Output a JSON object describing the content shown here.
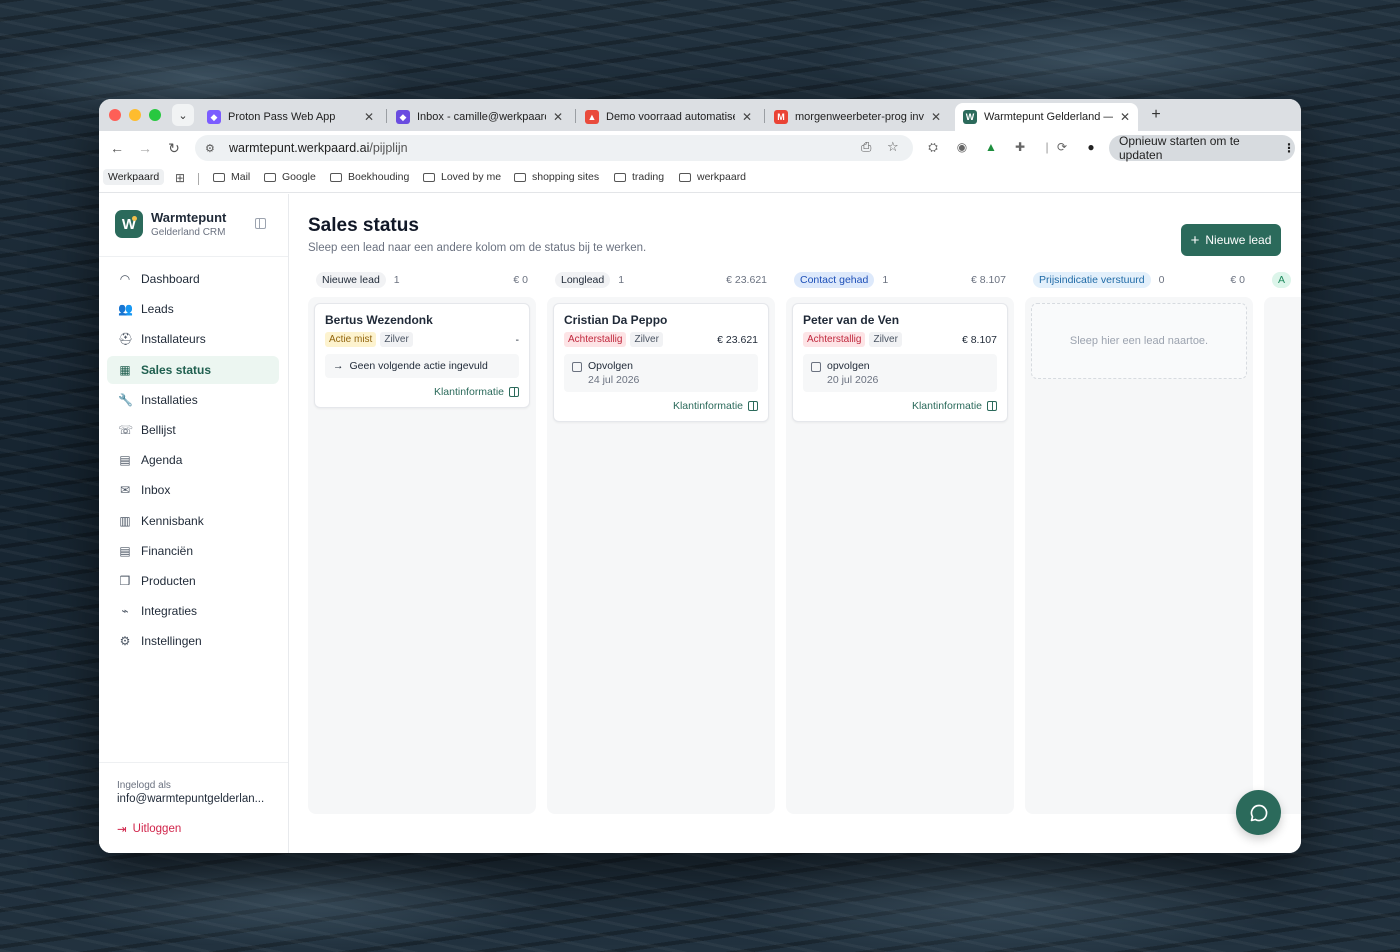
{
  "browser": {
    "tabs": [
      {
        "title": "Proton Pass Web App",
        "favicon_color": "#7b5cff",
        "active": false
      },
      {
        "title": "Inbox - camille@werkpaard.ai",
        "favicon_color": "#6a4ce0",
        "active": false
      },
      {
        "title": "Demo voorraad automatisering",
        "favicon_color": "#e94b3c",
        "active": false
      },
      {
        "title": "morgenweerbeter-prog invite",
        "favicon_color": "#ea4335",
        "active": false
      },
      {
        "title": "Warmtepunt Gelderland — CRM",
        "favicon_color": "#2b6a5b",
        "active": true
      }
    ],
    "url_host": "warmtepunt.werkpaard.ai",
    "url_path": "/pijplijn",
    "update_button": "Opnieuw starten om te updaten",
    "bookmarks": {
      "profile": "Werkpaard",
      "folders": [
        "Mail",
        "Google",
        "Boekhouding",
        "Loved by me",
        "shopping sites",
        "trading",
        "werkpaard"
      ]
    }
  },
  "sidebar": {
    "brand_name": "Warmtepunt",
    "brand_sub": "Gelderland CRM",
    "items": [
      {
        "label": "Dashboard",
        "icon": "gauge-icon",
        "glyph": "◠",
        "active": false
      },
      {
        "label": "Leads",
        "icon": "users-icon",
        "glyph": "👥",
        "active": false
      },
      {
        "label": "Installateurs",
        "icon": "hardhat-icon",
        "glyph": "⛑",
        "active": false
      },
      {
        "label": "Sales status",
        "icon": "kanban-icon",
        "glyph": "▦",
        "active": true
      },
      {
        "label": "Installaties",
        "icon": "wrench-icon",
        "glyph": "🔧",
        "active": false
      },
      {
        "label": "Bellijst",
        "icon": "phone-icon",
        "glyph": "☏",
        "active": false
      },
      {
        "label": "Agenda",
        "icon": "calendar-icon",
        "glyph": "▤",
        "active": false
      },
      {
        "label": "Inbox",
        "icon": "inbox-icon",
        "glyph": "✉",
        "active": false
      },
      {
        "label": "Kennisbank",
        "icon": "library-icon",
        "glyph": "▥",
        "active": false
      },
      {
        "label": "Financiën",
        "icon": "receipt-icon",
        "glyph": "▤",
        "active": false
      },
      {
        "label": "Producten",
        "icon": "package-icon",
        "glyph": "❒",
        "active": false
      },
      {
        "label": "Integraties",
        "icon": "plug-icon",
        "glyph": "⌁",
        "active": false
      },
      {
        "label": "Instellingen",
        "icon": "gear-icon",
        "glyph": "⚙",
        "active": false
      }
    ],
    "logged_in_label": "Ingelogd als",
    "logged_in_email": "info@warmtepuntgelderlan...",
    "logout_label": "Uitloggen"
  },
  "main": {
    "title": "Sales status",
    "subtitle": "Sleep een lead naar een andere kolom om de status bij te werken.",
    "new_lead_label": "Nieuwe lead",
    "columns": [
      {
        "name": "Nieuwe lead",
        "count": "1",
        "total": "€ 0",
        "badge_bg": "#f1f2f4",
        "badge_color": "#1f2937",
        "cards": [
          {
            "name": "Bertus Wezendonk",
            "status": "Actie mist",
            "status_type": "warn",
            "tier": "Zilver",
            "amount": "-",
            "action": "Geen volgende actie ingevuld",
            "link": "Klantinformatie"
          }
        ]
      },
      {
        "name": "Longlead",
        "count": "1",
        "total": "€ 23.621",
        "badge_bg": "#f1f2f4",
        "badge_color": "#1f2937",
        "cards": [
          {
            "name": "Cristian Da Peppo",
            "status": "Achterstallig",
            "status_type": "overdue",
            "tier": "Zilver",
            "amount": "€ 23.621",
            "task_title": "Opvolgen",
            "task_date": "24 jul 2026",
            "link": "Klantinformatie"
          }
        ]
      },
      {
        "name": "Contact gehad",
        "count": "1",
        "total": "€ 8.107",
        "badge_bg": "#dde9fb",
        "badge_color": "#1d4fb8",
        "cards": [
          {
            "name": "Peter van de Ven",
            "status": "Achterstallig",
            "status_type": "overdue",
            "tier": "Zilver",
            "amount": "€ 8.107",
            "task_title": "opvolgen",
            "task_date": "20 jul 2026",
            "link": "Klantinformatie"
          }
        ]
      },
      {
        "name": "Prijsindicatie verstuurd",
        "count": "0",
        "total": "€ 0",
        "badge_bg": "#e3f0fb",
        "badge_color": "#1f6aa6",
        "cards": [],
        "empty_text": "Sleep hier een lead naartoe."
      },
      {
        "name": "A",
        "count": "",
        "total": "",
        "badge_bg": "#dcf5ea",
        "badge_color": "#1e8a5d",
        "cards": []
      }
    ]
  }
}
